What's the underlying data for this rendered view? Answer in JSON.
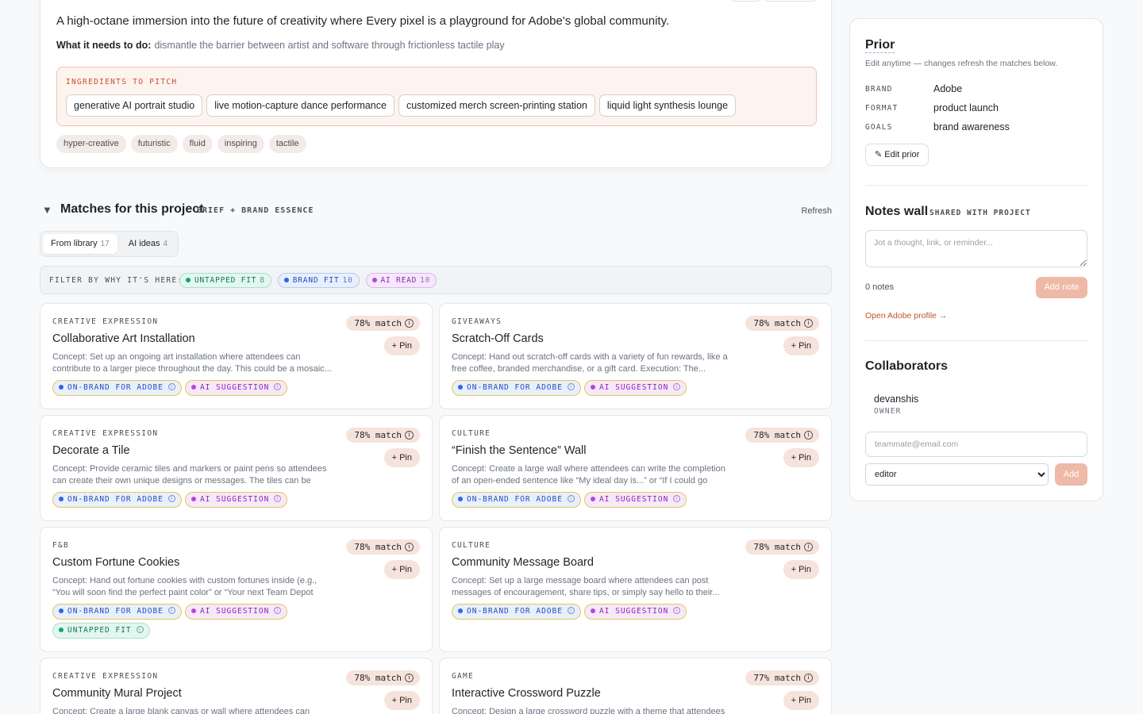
{
  "brief": {
    "description": "A high-octane immersion into the future of creativity where Every pixel is a playground for Adobe's global community.",
    "need_label": "What it needs to do:",
    "need_text": "dismantle the barrier between artist and software through frictionless tactile play",
    "ingredients_label": "INGREDIENTS TO PITCH",
    "ingredients": [
      "generative AI portrait studio",
      "live motion-capture dance performance",
      "customized merch screen-printing station",
      "liquid light synthesis lounge"
    ],
    "moods": [
      "hyper-creative",
      "futuristic",
      "fluid",
      "inspiring",
      "tactile"
    ]
  },
  "matches": {
    "title": "Matches for this project",
    "subtitle": "BRIEF + BRAND ESSENCE",
    "refresh_label": "Refresh",
    "tabs": [
      {
        "label": "From library",
        "count": "17"
      },
      {
        "label": "AI ideas",
        "count": "4"
      }
    ],
    "filter_label": "FILTER BY WHY IT'S HERE:",
    "filters": [
      {
        "label": "UNTAPPED FIT",
        "count": "8"
      },
      {
        "label": "BRAND FIT",
        "count": "10"
      },
      {
        "label": "AI READ",
        "count": "10"
      }
    ],
    "pin_label": "+ Pin",
    "badge_onbrand": "ON-BRAND FOR ADOBE",
    "badge_ai": "AI SUGGESTION",
    "badge_untapped": "UNTAPPED FIT",
    "cards": [
      {
        "category": "CREATIVE EXPRESSION",
        "title": "Collaborative Art Installation",
        "match": "78% match",
        "concept": "Concept: Set up an ongoing art installation where attendees can contribute to a larger piece throughout the day. This could be a mosaic..."
      },
      {
        "category": "GIVEAWAYS",
        "title": "Scratch-Off Cards",
        "match": "78% match",
        "concept": "Concept: Hand out scratch-off cards with a variety of fun rewards, like a free coffee, branded merchandise, or a gift card. Execution: The..."
      },
      {
        "category": "CREATIVE EXPRESSION",
        "title": "Decorate a Tile",
        "match": "78% match",
        "concept": "Concept: Provide ceramic tiles and markers or paint pens so attendees can create their own unique designs or messages. The tiles can be adde..."
      },
      {
        "category": "CULTURE",
        "title": "“Finish the Sentence” Wall",
        "match": "78% match",
        "concept": "Concept: Create a large wall where attendees can write the completion of an open-ended sentence like “My ideal day is...” or “If I could go anywhere..."
      },
      {
        "category": "F&B",
        "title": "Custom Fortune Cookies",
        "match": "78% match",
        "concept": "Concept: Hand out fortune cookies with custom fortunes inside (e.g., “You will soon find the perfect paint color” or “Your next Team Depot project wi..."
      },
      {
        "category": "CULTURE",
        "title": "Community Message Board",
        "match": "78% match",
        "concept": "Concept: Set up a large message board where attendees can post messages of encouragement, share tips, or simply say hello to their..."
      },
      {
        "category": "CREATIVE EXPRESSION",
        "title": "Community Mural Project",
        "match": "78% match",
        "concept": "Concept: Create a large blank canvas or wall where attendees can"
      },
      {
        "category": "GAME",
        "title": "Interactive Crossword Puzzle",
        "match": "77% match",
        "concept": "Concept: Design a large crossword puzzle with a theme that attendees"
      }
    ]
  },
  "sidebar": {
    "prior_title": "Prior",
    "prior_note": "Edit anytime — changes refresh the matches below.",
    "brand_key": "BRAND",
    "brand_val": "Adobe",
    "format_key": "FORMAT",
    "format_val": "product launch",
    "goals_key": "GOALS",
    "goals_val": "brand awareness",
    "edit_label": "✎ Edit prior",
    "notes_title": "Notes wall",
    "notes_sub": "SHARED WITH PROJECT",
    "notes_placeholder": "Jot a thought, link, or reminder...",
    "notes_count": "0 notes",
    "add_note": "Add note",
    "profile_link": "Open Adobe profile →",
    "collab_title": "Collaborators",
    "collab_name": "devanshis",
    "collab_role": "OWNER",
    "email_placeholder": "teammate@email.com",
    "role_selected": "editor",
    "add_label": "Add"
  },
  "colors": {
    "accent": "#c0542b",
    "match_bg": "#f6e3dc",
    "button_disabled": "#eeb9a6"
  }
}
